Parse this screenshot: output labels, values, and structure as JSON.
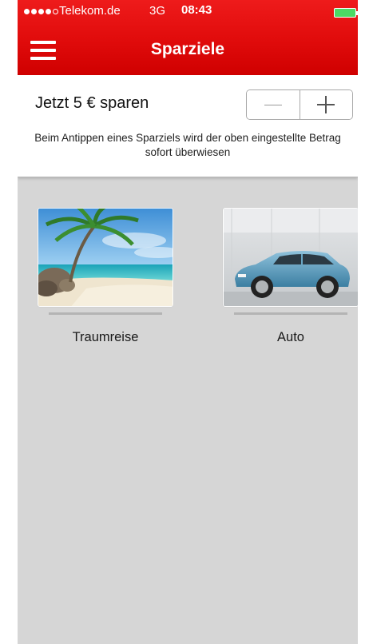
{
  "status_bar": {
    "carrier": "Telekom.de",
    "network": "3G",
    "time": "08:43"
  },
  "nav": {
    "title": "Sparziele",
    "menu_icon": "hamburger-menu-icon"
  },
  "amount": {
    "label": "Jetzt 5 € sparen",
    "hint": "Beim Antippen eines Sparziels wird der oben eingestellte Betrag sofort überwiesen",
    "minus_icon": "minus-icon",
    "plus_icon": "plus-icon"
  },
  "goals": [
    {
      "label": "Traumreise",
      "image": "beach-palm-photo"
    },
    {
      "label": "Auto",
      "image": "blue-car-photo"
    }
  ],
  "colors": {
    "header_red": "#e00b0b",
    "background_gray": "#d6d6d6",
    "battery_green": "#4cd964"
  }
}
